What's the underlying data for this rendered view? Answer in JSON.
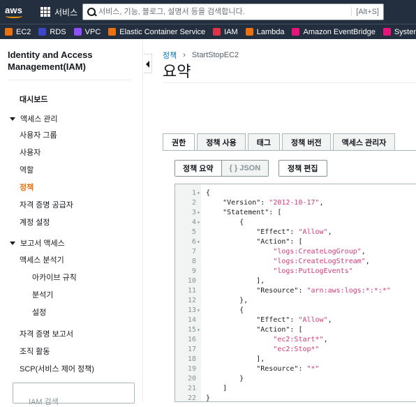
{
  "topbar": {
    "logo": "aws",
    "services_label": "서비스",
    "search_placeholder": "서비스, 기능, 블로그, 설명서 등을 검색합니다.",
    "search_shortcut": "[Alt+S]"
  },
  "favorites": [
    {
      "label": "EC2",
      "icon": "ec2-icon",
      "color": "#ec7211"
    },
    {
      "label": "RDS",
      "icon": "rds-icon",
      "color": "#3b48cc"
    },
    {
      "label": "VPC",
      "icon": "vpc-icon",
      "color": "#8c4fff"
    },
    {
      "label": "Elastic Container Service",
      "icon": "ecs-icon",
      "color": "#ec7211"
    },
    {
      "label": "IAM",
      "icon": "iam-icon",
      "color": "#dd344c"
    },
    {
      "label": "Lambda",
      "icon": "lambda-icon",
      "color": "#ec7211"
    },
    {
      "label": "Amazon EventBridge",
      "icon": "eventbridge-icon",
      "color": "#e7157b"
    },
    {
      "label": "Systems Manager",
      "icon": "ssm-icon",
      "color": "#e7157b"
    }
  ],
  "sidebar": {
    "title": "Identity and Access Management(IAM)",
    "dashboard": "대시보드",
    "access_management": {
      "label": "액세스 관리",
      "items": [
        "사용자 그룹",
        "사용자",
        "역할",
        "정책",
        "자격 증명 공급자",
        "계정 설정"
      ],
      "active": "정책"
    },
    "access_reports": {
      "label": "보고서 액세스",
      "analyzer": "액세스 분석기",
      "analyzer_items": [
        "아카이브 규칙",
        "분석기",
        "설정"
      ],
      "items": [
        "자격 증명 보고서",
        "조직 활동",
        "SCP(서비스 제어 정책)"
      ]
    },
    "search_placeholder": "IAM 검색"
  },
  "breadcrumb": {
    "parent": "정책",
    "current": "StartStopEC2"
  },
  "page_title": "요약",
  "tabs": [
    "권한",
    "정책 사용",
    "태그",
    "정책 버전",
    "액세스 관리자"
  ],
  "active_tab": "권한",
  "buttons": {
    "summary": "정책 요약",
    "json": "{ } JSON",
    "edit": "정책 편집"
  },
  "policy_lines": [
    {
      "n": "1",
      "fold": "▾",
      "text": "{"
    },
    {
      "n": "2",
      "fold": "",
      "text": "    \"Version\": \"2012-10-17\","
    },
    {
      "n": "3",
      "fold": "▾",
      "text": "    \"Statement\": ["
    },
    {
      "n": "4",
      "fold": "▾",
      "text": "        {"
    },
    {
      "n": "5",
      "fold": "",
      "text": "            \"Effect\": \"Allow\","
    },
    {
      "n": "6",
      "fold": "▾",
      "text": "            \"Action\": ["
    },
    {
      "n": "7",
      "fold": "",
      "text": "                \"logs:CreateLogGroup\","
    },
    {
      "n": "8",
      "fold": "",
      "text": "                \"logs:CreateLogStream\","
    },
    {
      "n": "9",
      "fold": "",
      "text": "                \"logs:PutLogEvents\""
    },
    {
      "n": "10",
      "fold": "",
      "text": "            ],"
    },
    {
      "n": "11",
      "fold": "",
      "text": "            \"Resource\": \"arn:aws:logs:*:*:*\""
    },
    {
      "n": "12",
      "fold": "",
      "text": "        },"
    },
    {
      "n": "13",
      "fold": "▾",
      "text": "        {"
    },
    {
      "n": "14",
      "fold": "",
      "text": "            \"Effect\": \"Allow\","
    },
    {
      "n": "15",
      "fold": "▾",
      "text": "            \"Action\": ["
    },
    {
      "n": "16",
      "fold": "",
      "text": "                \"ec2:Start*\","
    },
    {
      "n": "17",
      "fold": "",
      "text": "                \"ec2:Stop*\""
    },
    {
      "n": "18",
      "fold": "",
      "text": "            ],"
    },
    {
      "n": "19",
      "fold": "",
      "text": "            \"Resource\": \"*\""
    },
    {
      "n": "20",
      "fold": "",
      "text": "        }"
    },
    {
      "n": "21",
      "fold": "",
      "text": "    ]"
    },
    {
      "n": "22",
      "fold": "",
      "text": "}"
    }
  ],
  "colors": {
    "active_nav": "#ec7211",
    "string": "#d23a79",
    "topbar": "#232f3e",
    "link": "#0073bb"
  }
}
